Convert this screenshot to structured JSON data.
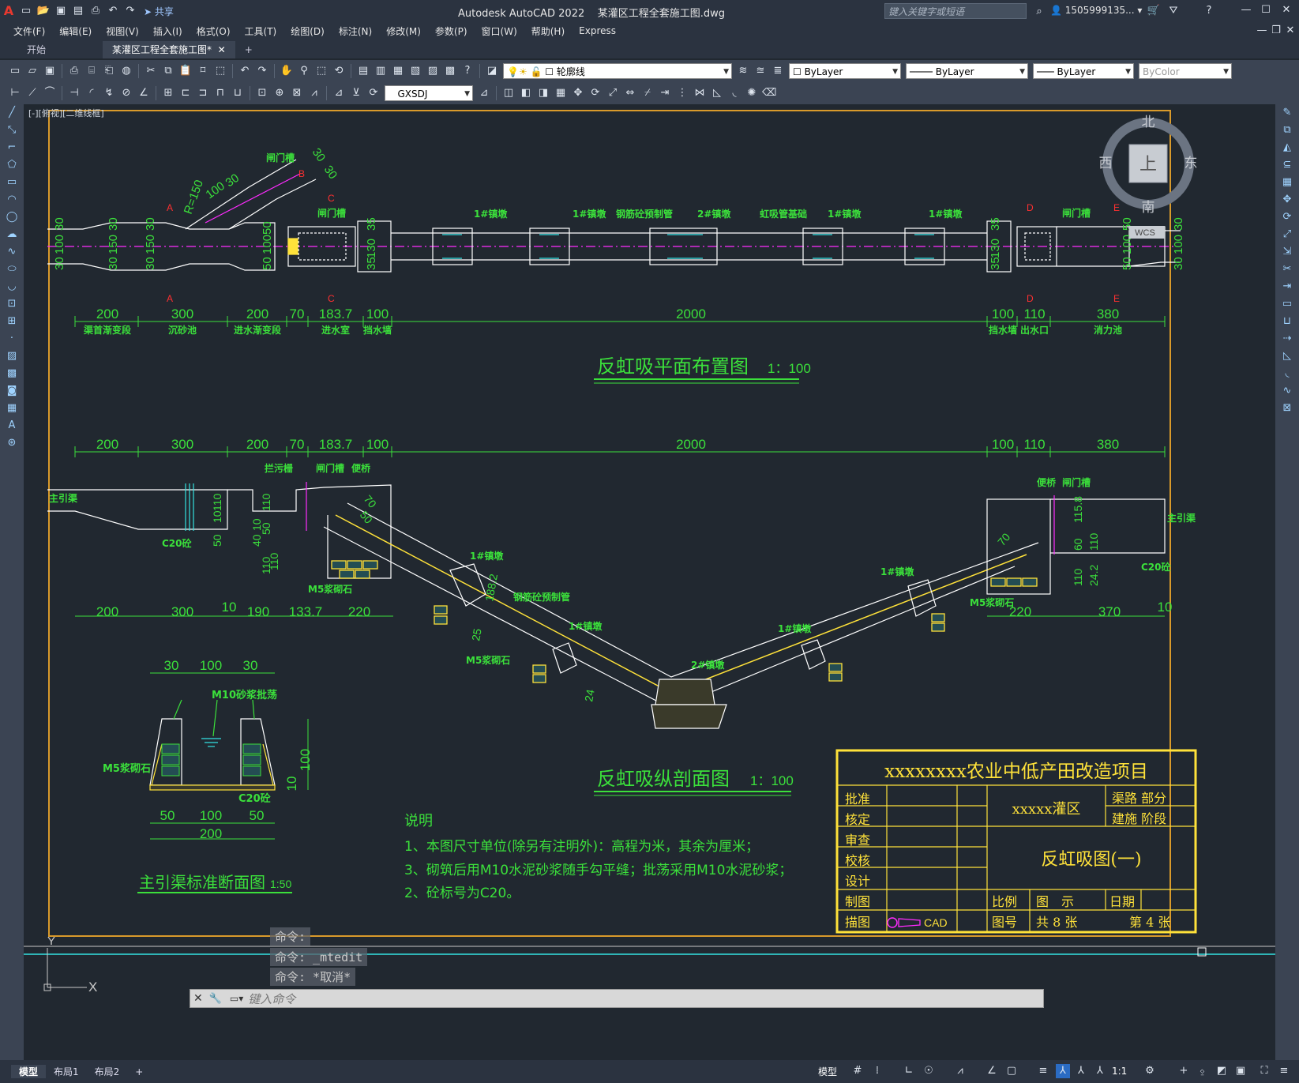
{
  "title_bar": {
    "app_title": "Autodesk AutoCAD 2022",
    "file_name": "某灌区工程全套施工图.dwg",
    "share_label": "共享",
    "search_placeholder": "键入关键字或短语",
    "user_name": "1505999135..."
  },
  "menu": [
    "文件(F)",
    "编辑(E)",
    "视图(V)",
    "插入(I)",
    "格式(O)",
    "工具(T)",
    "绘图(D)",
    "标注(N)",
    "修改(M)",
    "参数(P)",
    "窗口(W)",
    "帮助(H)",
    "Express"
  ],
  "doc_tabs": {
    "start": "开始",
    "active": "某灌区工程全套施工图*",
    "add": "+"
  },
  "toolbar": {
    "layer_name": "轮廓线",
    "color": "ByLayer",
    "linetype": "ByLayer",
    "lineweight": "ByLayer",
    "plotstyle": "ByColor",
    "dimstyle": "GXSDJ"
  },
  "viewport_label": "[-][俯视][二维线框]",
  "viewcube": {
    "north": "北",
    "south": "南",
    "west": "西",
    "east": "东",
    "top": "上",
    "wcs": "WCS"
  },
  "plan": {
    "title": "反虹吸平面布置图",
    "scale": "1：100",
    "dims": [
      "200",
      "300",
      "200",
      "70",
      "183.7",
      "100",
      "2000",
      "100",
      "110",
      "380"
    ],
    "segments": [
      "渠首渐变段",
      "沉砂池",
      "进水渐变段",
      "进水室",
      "挡水墙",
      "挡水墙",
      "出水口",
      "消力池"
    ],
    "labels": [
      "闸门槽",
      "闸门槽",
      "1#镇墩",
      "1#镇墩",
      "钢筋砼预制管",
      "2#镇墩",
      "虹吸管基础",
      "1#镇墩",
      "1#镇墩",
      "闸门槽"
    ],
    "vdims_left": [
      "30",
      "100",
      "30",
      "30",
      "150",
      "30",
      "30",
      "150",
      "30"
    ],
    "vdims_mid": [
      "50",
      "100",
      "50",
      "35",
      "130",
      "35"
    ],
    "vdims_right": [
      "35",
      "130",
      "35",
      "50",
      "100",
      "50",
      "30",
      "100",
      "30"
    ],
    "angled": [
      "R=150",
      "100",
      "30",
      "30",
      "30",
      "B"
    ],
    "section_marks": [
      "A",
      "A",
      "C",
      "C",
      "D",
      "D",
      "E",
      "E"
    ]
  },
  "profile": {
    "title": "反虹吸纵剖面图",
    "scale": "1：100",
    "top_dims": [
      "200",
      "300",
      "200",
      "70",
      "183.7",
      "100",
      "2000",
      "100",
      "110",
      "380"
    ],
    "bottom_dims_left": [
      "200",
      "300",
      "10",
      "190",
      "133.7",
      "220"
    ],
    "bottom_dims_right": [
      "220",
      "370",
      "10"
    ],
    "labels": [
      "主引渠",
      "拦污栅",
      "闸门槽",
      "便桥",
      "C20砼",
      "M5浆砌石",
      "1#镇墩",
      "钢筋砼预制管",
      "M5浆砌石",
      "1#镇墩",
      "2#镇墩",
      "1#镇墩",
      "1#镇墩",
      "便桥",
      "闸门槽",
      "主引渠",
      "C20砼",
      "M5浆砌石"
    ],
    "vdims": [
      "110",
      "10",
      "50",
      "110",
      "110",
      "10",
      "40",
      "50",
      "110",
      "70",
      "50",
      "188.2",
      "25",
      "24",
      "70",
      "60",
      "115.8",
      "110",
      "24.2",
      "110"
    ]
  },
  "section": {
    "title": "主引渠标准断面图",
    "scale": "1:50",
    "top_dims": [
      "30",
      "100",
      "30"
    ],
    "bottom_dims": [
      "50",
      "100",
      "50",
      "200"
    ],
    "labels": [
      "M10砂浆批荡",
      "M5浆砌石",
      "C20砼"
    ],
    "vdims": [
      "100",
      "10"
    ]
  },
  "notes": {
    "heading": "说明",
    "lines": [
      "1、本图尺寸单位(除另有注明外)：高程为米，其余为厘米；",
      "3、砌筑后用M10水泥砂浆随手勾平缝；批荡采用M10水泥砂浆；",
      "2、砼标号为C20。"
    ]
  },
  "titleblock": {
    "project": "xxxxxxxx农业中低产田改造项目",
    "area": "xxxxx灌区",
    "dept1": "渠路  部分",
    "dept2": "建施  阶段",
    "drawing": "反虹吸图(一)",
    "roles": [
      "批准",
      "核定",
      "审查",
      "校核",
      "设计",
      "制图",
      "描图"
    ],
    "scale_label": "比例",
    "scale_value": "图　示",
    "date_label": "日期",
    "no_label": "图号",
    "total": "共 8 张",
    "sheet": "第 4 张",
    "cad": "CAD"
  },
  "ucs": {
    "x": "X",
    "y": "Y"
  },
  "command": {
    "history": [
      "命令:",
      "命令: _mtedit",
      "命令: *取消*"
    ],
    "placeholder": "键入命令"
  },
  "status": {
    "tabs": [
      "模型",
      "布局1",
      "布局2"
    ],
    "add": "+",
    "model_btn": "模型",
    "scale": "1:1"
  },
  "colors": {
    "green": "#3be03b",
    "yellow": "#ffe23a",
    "cyan": "#34e2e2",
    "magenta": "#ff2bff",
    "white": "#ffffff",
    "frame": "#d99a2b"
  }
}
